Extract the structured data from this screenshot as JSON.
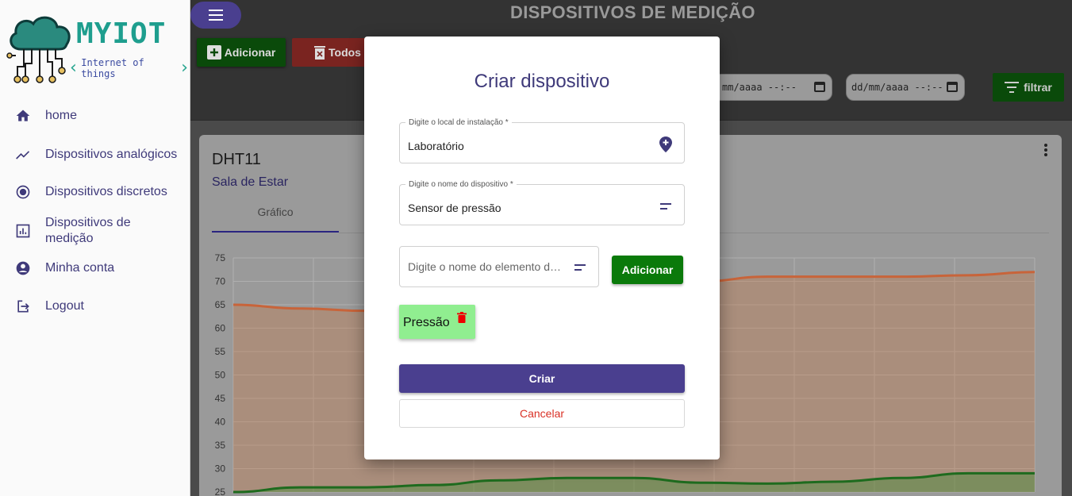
{
  "app": {
    "logo_title": "MYIOT",
    "logo_subtitle": "Internet of things",
    "page_title": "DISPOSITIVOS DE MEDIÇÃO"
  },
  "sidebar": {
    "items": [
      {
        "label": "home",
        "icon": "home-icon"
      },
      {
        "label": "Dispositivos analógicos",
        "icon": "trending-up-icon"
      },
      {
        "label": "Dispositivos discretos",
        "icon": "radio-button-icon"
      },
      {
        "label": "Dispositivos de medição",
        "icon": "bar-chart-icon"
      },
      {
        "label": "Minha conta",
        "icon": "account-circle-icon"
      },
      {
        "label": "Logout",
        "icon": "logout-icon"
      }
    ]
  },
  "toolbar": {
    "add_label": "Adicionar",
    "delete_all_label": "Todos",
    "date_from": "mm/aaaa --:--",
    "date_to": "dd/mm/aaaa --:--",
    "filter_label": "filtrar"
  },
  "card": {
    "title": "DHT11",
    "subtitle": "Sala de Estar",
    "tab_label": "Gráfico"
  },
  "chart_data": {
    "type": "area",
    "ylim": [
      25,
      75
    ],
    "yticks": [
      "75",
      "70",
      "65",
      "60",
      "55",
      "50",
      "45",
      "40",
      "35",
      "30",
      "25"
    ],
    "series": [
      {
        "values": [
          65,
          64.2,
          63.7,
          63.8,
          64.5,
          65.5,
          66.5,
          70,
          71,
          71,
          71,
          71.3,
          72
        ],
        "color": "#c8643a"
      },
      {
        "values": [
          25,
          26,
          26,
          26.5,
          27.5,
          28,
          28,
          27,
          26.8,
          27.2,
          28,
          29,
          29
        ],
        "color": "#1e6b1e"
      }
    ]
  },
  "modal": {
    "title": "Criar dispositivo",
    "location_label": "Digite o local de instalação *",
    "location_value": "Laboratório",
    "name_label": "Digite o nome do dispositivo *",
    "name_value": "Sensor de pressão",
    "element_placeholder": "Digite o nome do elemento de medição",
    "add_element_label": "Adicionar",
    "chips": [
      "Pressão"
    ],
    "create_label": "Criar",
    "cancel_label": "Cancelar"
  },
  "colors": {
    "primary": "#4a3f8f",
    "success": "#0a7a0a",
    "danger": "#d93025",
    "chip": "#90ee90"
  }
}
